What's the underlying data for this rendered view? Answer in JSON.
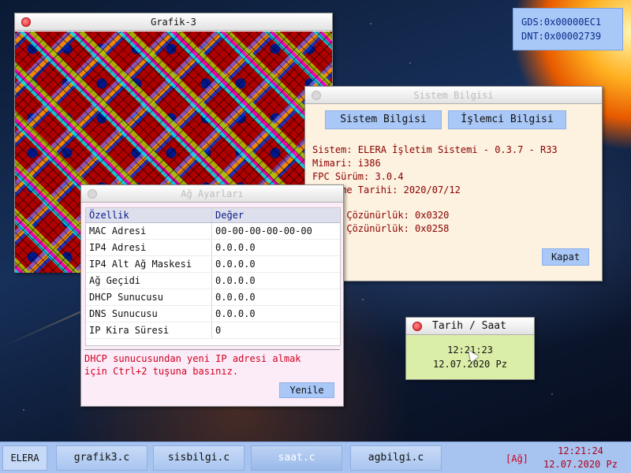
{
  "desktop": {
    "info": {
      "gds": "GDS:0x00000EC1",
      "dnt": "DNT:0x00002739"
    }
  },
  "windows": {
    "grafik": {
      "title": "Grafik-3"
    },
    "sistem": {
      "title": "Sistem Bilgisi",
      "tabs": [
        "Sistem Bilgisi",
        "İşlemci Bilgisi"
      ],
      "lines": [
        "Sistem: ELERA İşletim Sistemi - 0.3.7 - R33",
        "Mimari: i386",
        "FPC Sürüm: 3.0.4",
        "Derleme Tarihi: 2020/07/12",
        "",
        "Yatay Çözünürlük: 0x0320",
        "Dikey Çözünürlük: 0x0258"
      ],
      "close_label": "Kapat"
    },
    "ag": {
      "title": "Ağ Ayarları",
      "columns": [
        "Özellik",
        "Değer"
      ],
      "rows": [
        [
          "MAC Adresi",
          "00-00-00-00-00-00"
        ],
        [
          "IP4 Adresi",
          "0.0.0.0"
        ],
        [
          "IP4 Alt Ağ Maskesi",
          "0.0.0.0"
        ],
        [
          "Ağ Geçidi",
          "0.0.0.0"
        ],
        [
          "DHCP Sunucusu",
          "0.0.0.0"
        ],
        [
          "DNS Sunucusu",
          "0.0.0.0"
        ],
        [
          "IP Kira Süresi",
          "0"
        ]
      ],
      "note_line1": "DHCP sunucusundan yeni IP adresi almak",
      "note_line2": "için Ctrl+2 tuşuna basınız.",
      "refresh_label": "Yenile"
    },
    "saat": {
      "title": "Tarih / Saat",
      "time": "12:21:23",
      "date": "12.07.2020 Pz"
    }
  },
  "taskbar": {
    "start_label": "ELERA",
    "tasks": [
      "grafik3.c",
      "sisbilgi.c",
      "saat.c",
      "agbilgi.c"
    ],
    "net_label": "[Ağ]",
    "time": "12:21:24",
    "date": "12.07.2020 Pz"
  },
  "colors": {
    "taskbar": "#a7c4f0",
    "button": "#a9c8f7",
    "sysinfo_text": "#8a0000",
    "alert_text": "#d00020"
  }
}
